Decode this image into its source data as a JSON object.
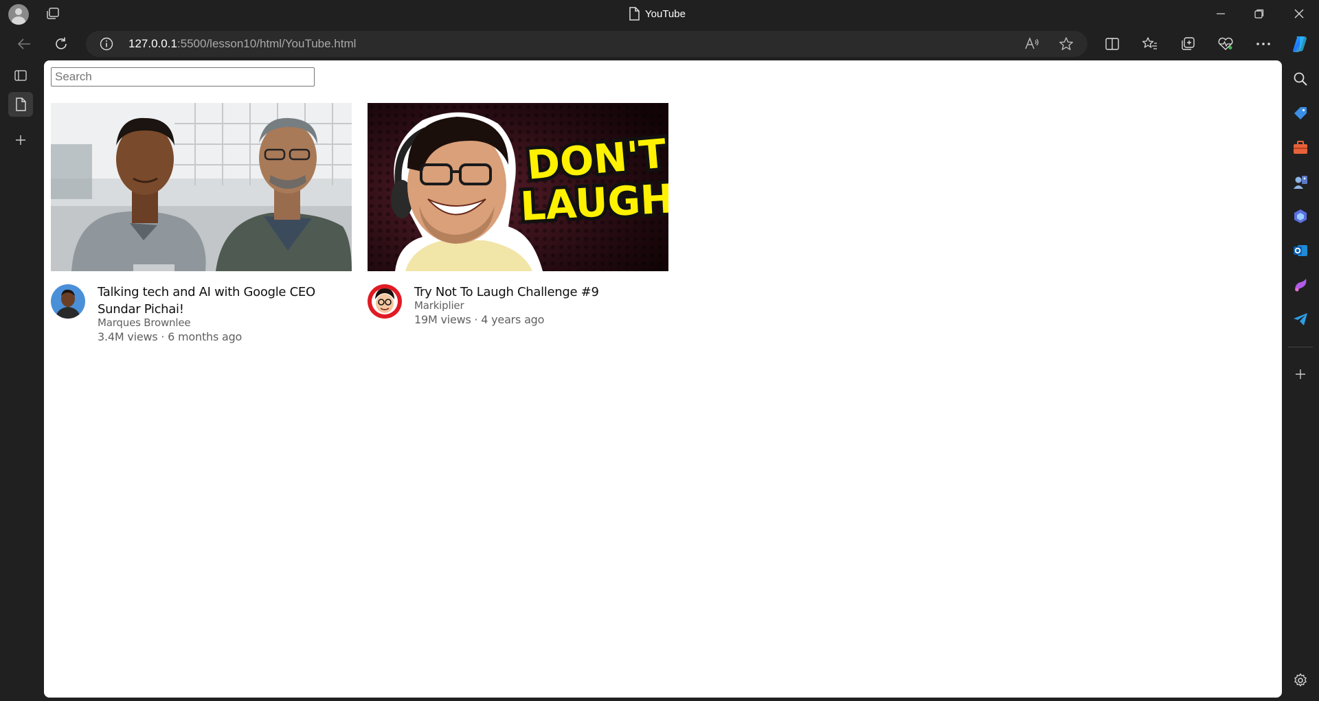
{
  "window": {
    "title": "YouTube",
    "controls": [
      "minimize-icon",
      "restore-icon",
      "close-icon"
    ]
  },
  "toolbar": {
    "url_host": "127.0.0.1",
    "url_rest": ":5500/lesson10/html/YouTube.html"
  },
  "search": {
    "placeholder": "Search",
    "value": ""
  },
  "videos": [
    {
      "title": "Talking tech and AI with Google CEO Sundar Pichai!",
      "channel": "Marques Brownlee",
      "stats": "3.4M views · 6 months ago",
      "thumbnail_icon": "mkbhd-pichai-thumbnail",
      "avatar_icon": "marques-brownlee-avatar"
    },
    {
      "title": "Try Not To Laugh Challenge #9",
      "channel": "Markiplier",
      "stats": "19M views · 4 years ago",
      "thumbnail_icon": "dont-laugh-thumbnail",
      "thumbnail_text": [
        "DON'T",
        "LAUGH"
      ],
      "avatar_icon": "markiplier-avatar"
    }
  ],
  "colors": {
    "browser_chrome": "#202020",
    "address_bar": "#2b2b2b",
    "thumbnail_text_yellow": "#fff200"
  }
}
